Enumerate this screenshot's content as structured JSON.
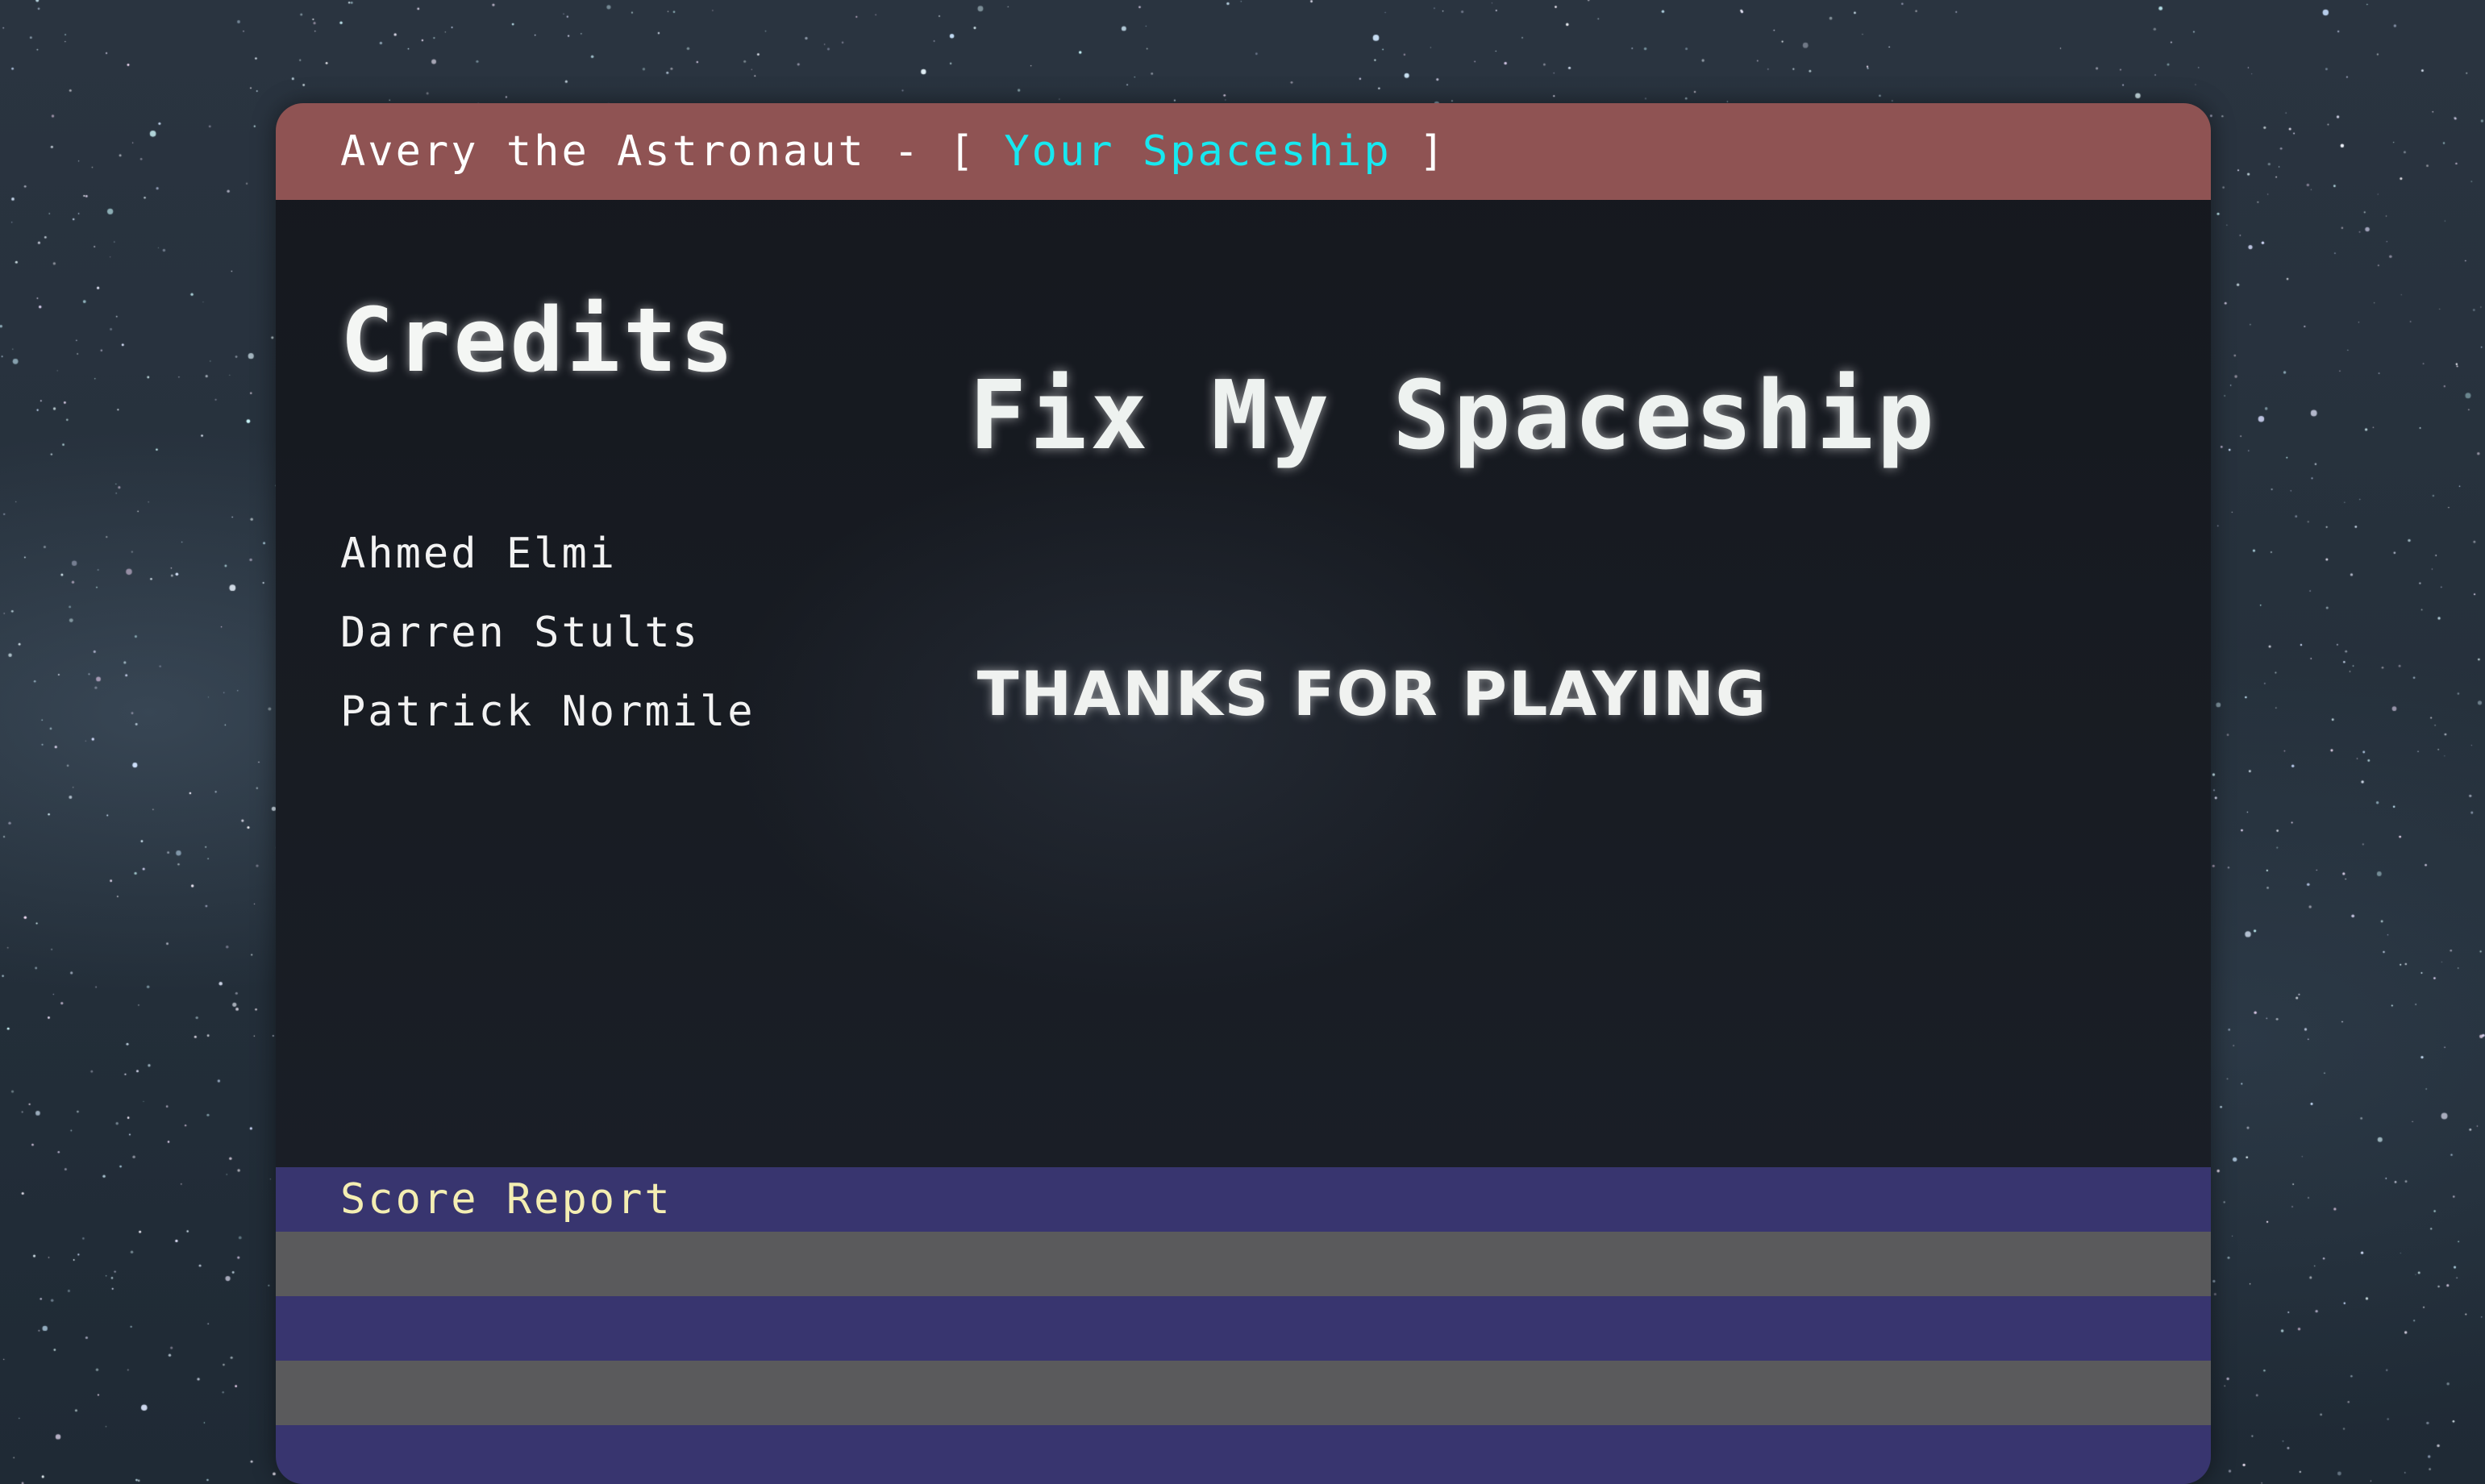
{
  "window": {
    "title_prefix": "Avery the Astronaut - [ ",
    "title_accent": "Your Spaceship",
    "title_suffix": " ]",
    "titlebar_color": "#8f5353",
    "accent_color": "#17e8f0"
  },
  "credits": {
    "heading": "Credits",
    "names": [
      "Ahmed Elmi",
      "Darren Stults",
      "Patrick Normile"
    ]
  },
  "main": {
    "game_title": "Fix My Spaceship",
    "message": "THANKS FOR PLAYING"
  },
  "score_report": {
    "label": "Score Report",
    "row_colors": [
      "#38356f",
      "#5a5a5c",
      "#38356f",
      "#5a5a5c",
      "#38356f"
    ]
  }
}
